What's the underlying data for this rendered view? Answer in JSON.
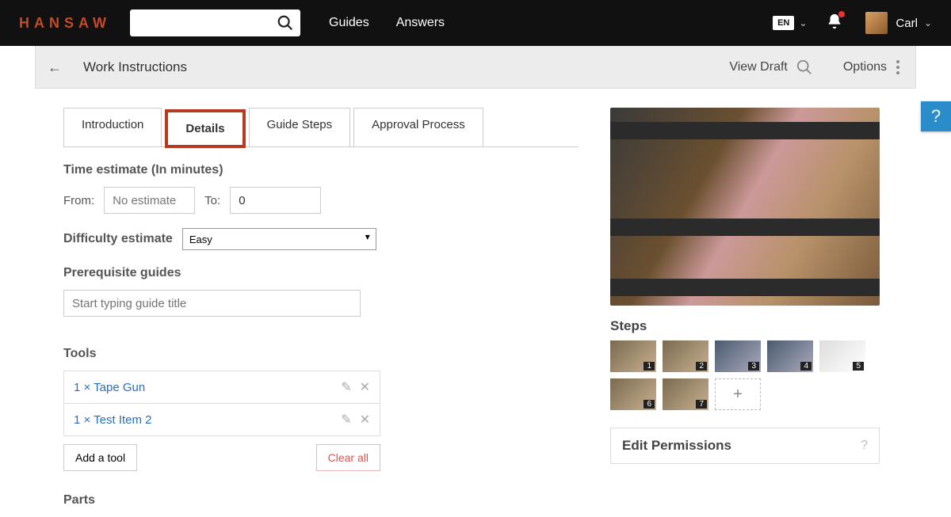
{
  "brand": "HANSAW",
  "nav": {
    "guides": "Guides",
    "answers": "Answers",
    "lang": "EN",
    "user": "Carl"
  },
  "subheader": {
    "title": "Work Instructions",
    "view_draft": "View Draft",
    "options": "Options"
  },
  "tabs": {
    "intro": "Introduction",
    "details": "Details",
    "steps": "Guide Steps",
    "approval": "Approval Process",
    "active": "details"
  },
  "time_estimate": {
    "heading": "Time estimate (In minutes)",
    "from_label": "From:",
    "from_placeholder": "No estimate",
    "from_value": "",
    "to_label": "To:",
    "to_value": "0"
  },
  "difficulty": {
    "label": "Difficulty estimate",
    "value": "Easy"
  },
  "prereq": {
    "label": "Prerequisite guides",
    "placeholder": "Start typing guide title"
  },
  "tools": {
    "label": "Tools",
    "items": [
      {
        "text": "1 × Tape Gun"
      },
      {
        "text": "1 × Test Item 2"
      }
    ],
    "add_label": "Add a tool",
    "clear_label": "Clear all"
  },
  "parts": {
    "label": "Parts"
  },
  "steps_panel": {
    "label": "Steps",
    "thumbs": [
      "1",
      "2",
      "3",
      "4",
      "5",
      "6",
      "7"
    ]
  },
  "permissions": {
    "title": "Edit Permissions"
  },
  "help": "?"
}
